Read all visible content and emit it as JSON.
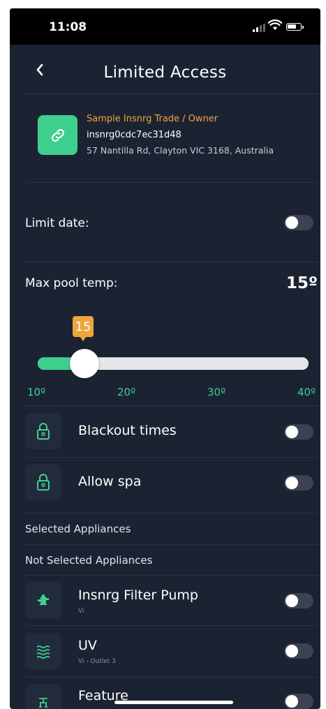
{
  "status_bar": {
    "time": "11:08"
  },
  "header": {
    "title": "Limited Access"
  },
  "owner": {
    "name": "Sample Insnrg Trade / Owner",
    "id": "insnrg0cdc7ec31d48",
    "address": "57 Nantilla Rd, Clayton VIC 3168, Australia"
  },
  "limit_date": {
    "label": "Limit date:",
    "enabled": false
  },
  "max_pool_temp": {
    "label": "Max pool temp:",
    "value_display": "15º",
    "value": 15,
    "min": 10,
    "max": 40,
    "bubble": "15",
    "ticks": [
      "10º",
      "20º",
      "30º",
      "40º"
    ]
  },
  "blackout_times": {
    "label": "Blackout times",
    "icon": "lock-icon",
    "enabled": false
  },
  "allow_spa": {
    "label": "Allow spa",
    "icon": "lock-icon",
    "enabled": false
  },
  "sections": {
    "selected": "Selected Appliances",
    "not_selected": "Not Selected Appliances"
  },
  "appliances": [
    {
      "name": "Insnrg Filter Pump",
      "sub": "Vi",
      "icon": "pump-icon",
      "enabled": false
    },
    {
      "name": "UV",
      "sub": "Vi - Outlet 3",
      "icon": "uv-waves-icon",
      "enabled": false
    },
    {
      "name": "Feature",
      "sub": "",
      "icon": "feature-icon",
      "enabled": false
    }
  ],
  "colors": {
    "background": "#1b2333",
    "accent": "#3ecf8e",
    "highlight": "#f0a53c",
    "toggle_off": "#3b4353"
  }
}
